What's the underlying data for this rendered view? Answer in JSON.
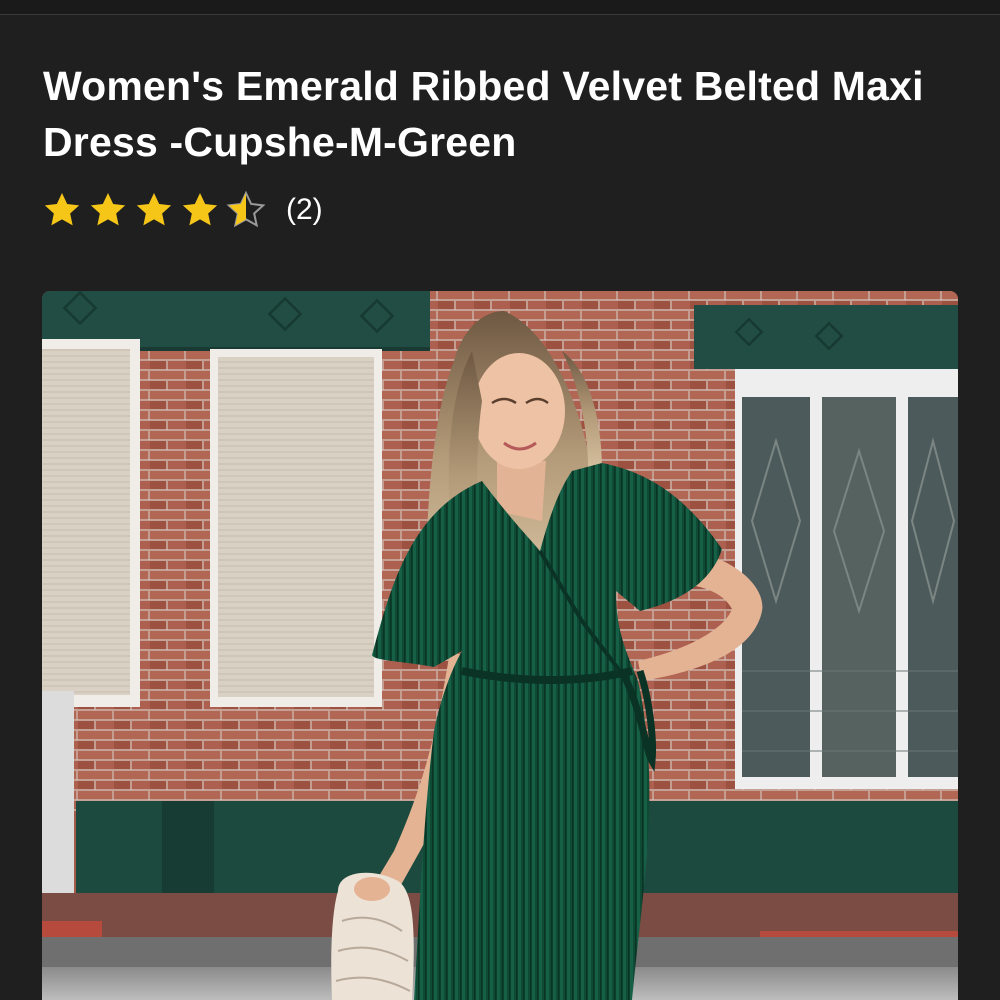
{
  "product": {
    "title": "Women's Emerald Ribbed Velvet Belted Maxi Dress -Cupshe-M-Green",
    "rating": {
      "value": 4.5,
      "max": 5,
      "review_count": "(2)",
      "star_color": "#f5c518"
    },
    "image": {
      "alt_subject": "woman in emerald green velvet wrap maxi dress"
    }
  },
  "colors": {
    "background": "#1f1f20",
    "text": "#ffffff",
    "dress": "#0f4a34",
    "brick": "#a55a4a"
  }
}
